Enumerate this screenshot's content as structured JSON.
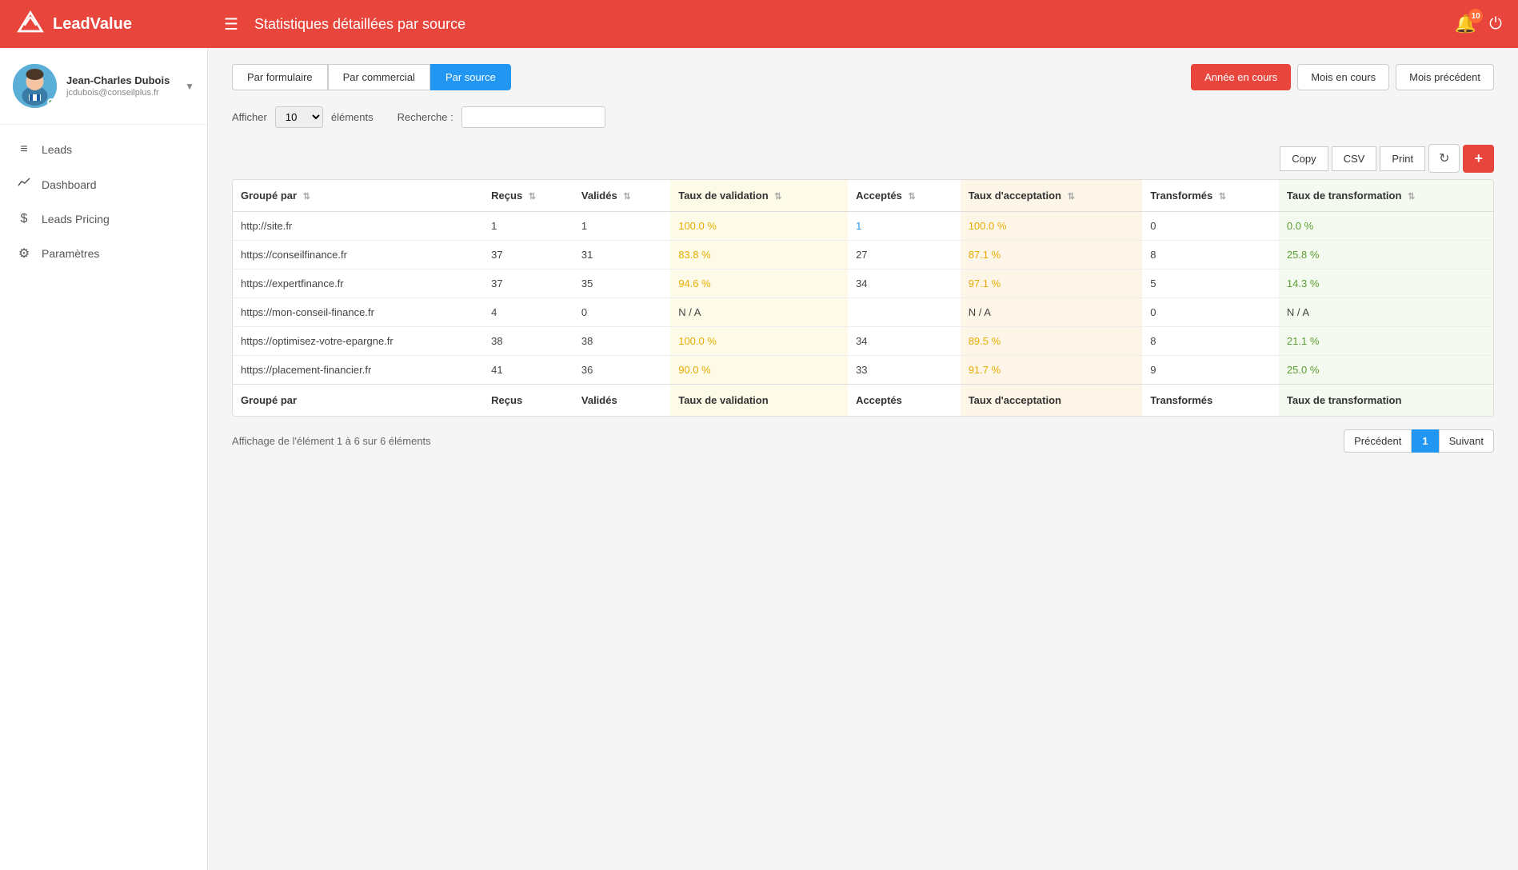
{
  "header": {
    "logo_text": "LeadValue",
    "page_title": "Statistiques détaillées par source",
    "notification_count": "10"
  },
  "user": {
    "name": "Jean-Charles Dubois",
    "email": "jcdubois@conseilplus.fr",
    "status": "online"
  },
  "sidebar": {
    "items": [
      {
        "id": "leads",
        "label": "Leads",
        "icon": "≡"
      },
      {
        "id": "dashboard",
        "label": "Dashboard",
        "icon": "📈"
      },
      {
        "id": "leads-pricing",
        "label": "Leads Pricing",
        "icon": "$"
      },
      {
        "id": "parametres",
        "label": "Paramètres",
        "icon": "⚙"
      }
    ]
  },
  "filters": {
    "view_buttons": [
      {
        "label": "Par formulaire",
        "active": false
      },
      {
        "label": "Par commercial",
        "active": false
      },
      {
        "label": "Par source",
        "active": true
      }
    ],
    "period_buttons": [
      {
        "label": "Année en cours",
        "active": true
      },
      {
        "label": "Mois en cours",
        "active": false
      },
      {
        "label": "Mois précédent",
        "active": false
      }
    ]
  },
  "show_row": {
    "afficher_label": "Afficher",
    "elements_label": "éléments",
    "search_label": "Recherche :",
    "show_value": "10"
  },
  "action_buttons": {
    "copy_label": "Copy",
    "csv_label": "CSV",
    "print_label": "Print"
  },
  "table": {
    "headers": [
      {
        "label": "Groupé par",
        "col": "group"
      },
      {
        "label": "Reçus",
        "col": "recus"
      },
      {
        "label": "Validés",
        "col": "valides"
      },
      {
        "label": "Taux de validation",
        "col": "taux_validation",
        "highlight": "yellow"
      },
      {
        "label": "Acceptés",
        "col": "acceptes"
      },
      {
        "label": "Taux d'acceptation",
        "col": "taux_acceptance",
        "highlight": "orange"
      },
      {
        "label": "Transformés",
        "col": "transformes"
      },
      {
        "label": "Taux de transformation",
        "col": "taux_transformation",
        "highlight": "green"
      }
    ],
    "rows": [
      {
        "group": "http://site.fr",
        "recus": "1",
        "valides": "1",
        "taux_validation": "100.0 %",
        "acceptes": "1",
        "taux_acceptance": "100.0 %",
        "transformes": "0",
        "taux_transformation": "0.0 %",
        "acceptes_blue": true
      },
      {
        "group": "https://conseilfinance.fr",
        "recus": "37",
        "valides": "31",
        "taux_validation": "83.8 %",
        "acceptes": "27",
        "taux_acceptance": "87.1 %",
        "transformes": "8",
        "taux_transformation": "25.8 %",
        "acceptes_blue": false
      },
      {
        "group": "https://expertfinance.fr",
        "recus": "37",
        "valides": "35",
        "taux_validation": "94.6 %",
        "acceptes": "34",
        "taux_acceptance": "97.1 %",
        "transformes": "5",
        "taux_transformation": "14.3 %",
        "acceptes_blue": false
      },
      {
        "group": "https://mon-conseil-finance.fr",
        "recus": "4",
        "valides": "0",
        "taux_validation": "N / A",
        "acceptes": "",
        "taux_acceptance": "N / A",
        "transformes": "0",
        "taux_transformation": "N / A",
        "acceptes_blue": false
      },
      {
        "group": "https://optimisez-votre-epargne.fr",
        "recus": "38",
        "valides": "38",
        "taux_validation": "100.0 %",
        "acceptes": "34",
        "taux_acceptance": "89.5 %",
        "transformes": "8",
        "taux_transformation": "21.1 %",
        "acceptes_blue": false
      },
      {
        "group": "https://placement-financier.fr",
        "recus": "41",
        "valides": "36",
        "taux_validation": "90.0 %",
        "acceptes": "33",
        "taux_acceptance": "91.7 %",
        "transformes": "9",
        "taux_transformation": "25.0 %",
        "acceptes_blue": false
      }
    ],
    "footer": {
      "group": "Groupé par",
      "recus": "Reçus",
      "valides": "Validés",
      "taux_validation": "Taux de validation",
      "acceptes": "Acceptés",
      "taux_acceptance": "Taux d'acceptation",
      "transformes": "Transformés",
      "taux_transformation": "Taux de transformation"
    }
  },
  "pagination": {
    "info": "Affichage de l'élément 1 à 6 sur 6 éléments",
    "prev_label": "Précédent",
    "current_page": "1",
    "next_label": "Suivant"
  }
}
